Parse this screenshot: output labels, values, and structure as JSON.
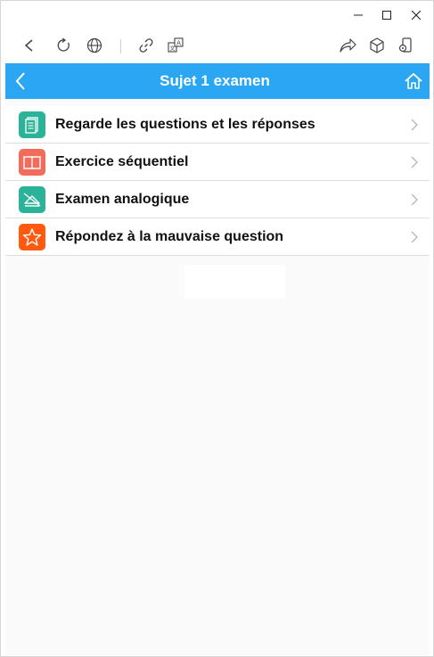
{
  "window": {
    "controls": [
      "minimize",
      "maximize",
      "close"
    ]
  },
  "toolbar": {
    "icons": [
      "back-icon",
      "refresh-icon",
      "globe-icon",
      "link-icon",
      "translate-icon",
      "share-icon",
      "cube-icon",
      "phone-icon"
    ]
  },
  "header": {
    "title": "Sujet 1 examen",
    "color": "#2aa6f2"
  },
  "menu": {
    "items": [
      {
        "label": "Regarde les questions et les réponses",
        "icon": "notes-icon",
        "color": "#2bb39a"
      },
      {
        "label": "Exercice séquentiel",
        "icon": "book-icon",
        "color": "#f26b5b"
      },
      {
        "label": "Examen analogique",
        "icon": "exam-icon",
        "color": "#2bb39a"
      },
      {
        "label": "Répondez à la mauvaise question",
        "icon": "star-icon",
        "color": "#ff5a0f"
      }
    ]
  }
}
